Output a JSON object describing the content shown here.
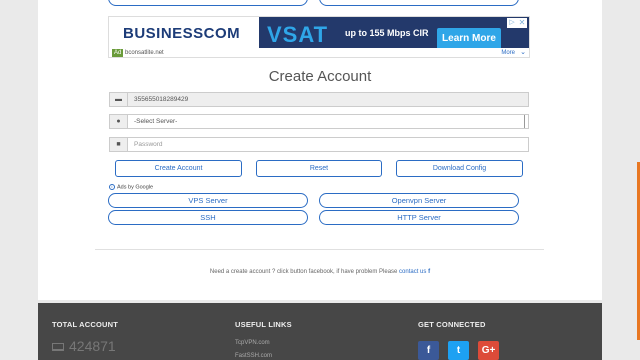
{
  "ad": {
    "brand": "BUSINESSCOM",
    "product": "VSAT",
    "offer": "up to 155 Mbps CIR",
    "cta": "Learn More",
    "badge": "Ad",
    "source": "bconsatlite.net",
    "more": "More",
    "close_glyph": "✕",
    "play_glyph": "▷",
    "more_glyph": "⌄"
  },
  "form": {
    "title": "Create Account",
    "fields": {
      "id_value": "355655018289429",
      "server_placeholder": "-Select Server-",
      "password_placeholder": "Password"
    },
    "icons": {
      "id": "id-card-icon",
      "server": "globe-icon",
      "password": "lock-icon"
    },
    "buttons": {
      "create": "Create Account",
      "reset": "Reset",
      "download": "Download Config"
    }
  },
  "ads_by": "Ads by Google",
  "server_links": [
    "VPS Server",
    "Openvpn Server",
    "SSH",
    "HTTP Server"
  ],
  "note": {
    "text": "Need a create account ? click button facebook, if have problem Please",
    "link": "contact us",
    "fb": "f"
  },
  "footer": {
    "total_title": "TOTAL ACCOUNT",
    "total_value": "424871",
    "useful_title": "USEFUL LINKS",
    "useful_links": [
      "TcpVPN.com",
      "FastSSH.com"
    ],
    "connected_title": "GET CONNECTED",
    "social": [
      {
        "label": "f",
        "color": "#3b5998"
      },
      {
        "label": "t",
        "color": "#1da1f2"
      },
      {
        "label": "G+",
        "color": "#dd4b39"
      }
    ]
  },
  "colors": {
    "accent": "#2b6cc4",
    "footer_bg": "#474747",
    "side_accent": "#e87722"
  }
}
